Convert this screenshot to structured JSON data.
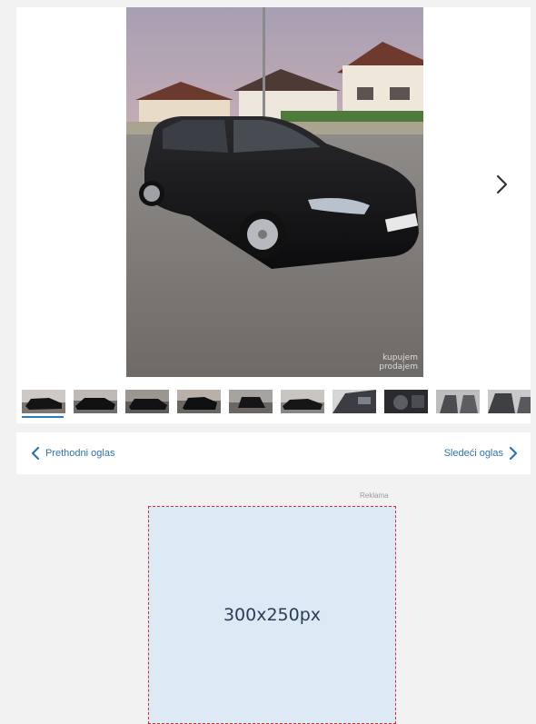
{
  "gallery": {
    "watermark_line1": "kupujem",
    "watermark_line2": "prodajem",
    "next_icon": "chevron-right-icon",
    "thumbnail_count": 10,
    "active_thumbnail_index": 0
  },
  "navigation": {
    "prev_label": "Prethodni oglas",
    "next_label": "Sledeći oglas"
  },
  "ad": {
    "label": "Reklama",
    "size_text": "300x250px"
  },
  "colors": {
    "accent": "#2b7bbf",
    "link": "#2f73ad",
    "ad_border": "#d32f2f",
    "ad_fill": "#dde9f5"
  }
}
